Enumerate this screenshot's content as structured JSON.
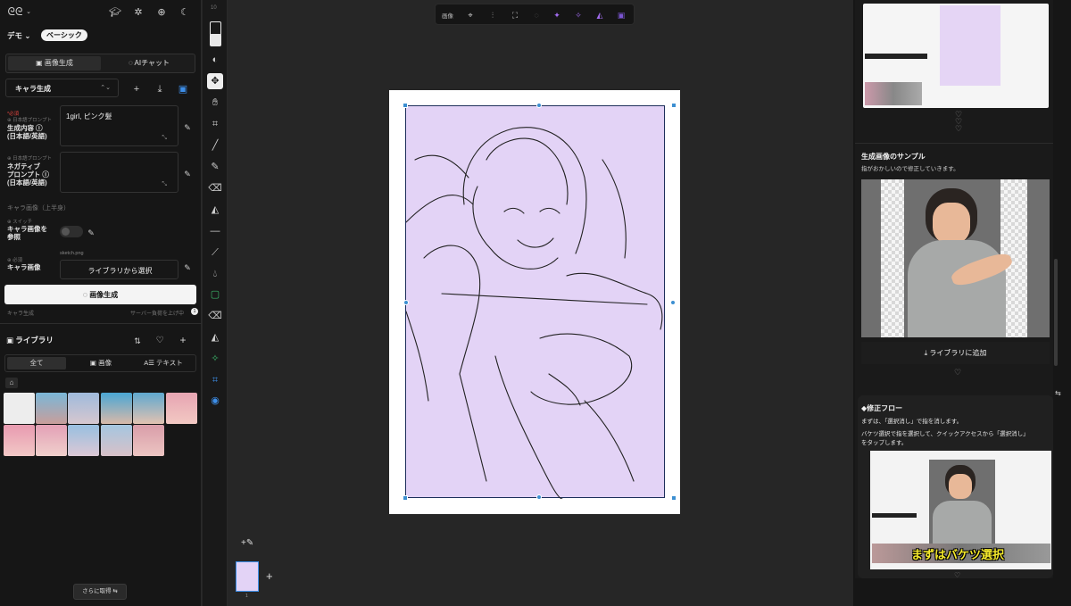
{
  "header": {
    "workspace": "デモ",
    "plan_badge": "ベーシック"
  },
  "mode_tabs": [
    {
      "label": "画像生成"
    },
    {
      "label": "AIチャット"
    }
  ],
  "preset": {
    "value": "キャラ生成"
  },
  "prompt": {
    "required_tag": "*必須",
    "small_hint": "日本語プロンプト",
    "label_line1": "生成内容",
    "label_line2": "(日本語/英語)",
    "value": "1girl, ピンク髪"
  },
  "negative": {
    "small_hint": "日本語プロンプト",
    "label_line1": "ネガティブ",
    "label_line2": "プロンプト",
    "label_line3": "(日本語/英語)"
  },
  "section_char_image": "キャラ画像（上半身）",
  "ref_switch": {
    "small": "スイッチ",
    "label_line1": "キャラ画像を",
    "label_line2": "参照"
  },
  "char_image": {
    "small": "必須",
    "label": "キャラ画像",
    "file": "sketch.png",
    "button": "ライブラリから選択"
  },
  "generate_button": "画像生成",
  "footer_left": "キャラ生成",
  "footer_right": "サーバー負荷を上げ中",
  "library": {
    "title": "ライブラリ",
    "tabs": [
      {
        "label": "全て"
      },
      {
        "label": "画像"
      },
      {
        "label": "テキスト"
      }
    ],
    "load_more": "さらに取得"
  },
  "right": {
    "sample_title": "生成画像のサンプル",
    "sample_desc": "指がおかしいので修正していきます。",
    "add_library": "ライブラリに追加",
    "flow_title": "◆修正フロー",
    "flow_line1": "まずは、「選択消し」で指を消します。",
    "flow_line2": "バケツ選択で指を選択して、クイックアクセスから「選択消し」",
    "flow_line3": "をタップします。",
    "caption": "まずはバケツ選択"
  },
  "canvas": {
    "topbar_label": "画像",
    "page_number": "1"
  },
  "toolbar": {
    "zoom_hint": "10"
  }
}
